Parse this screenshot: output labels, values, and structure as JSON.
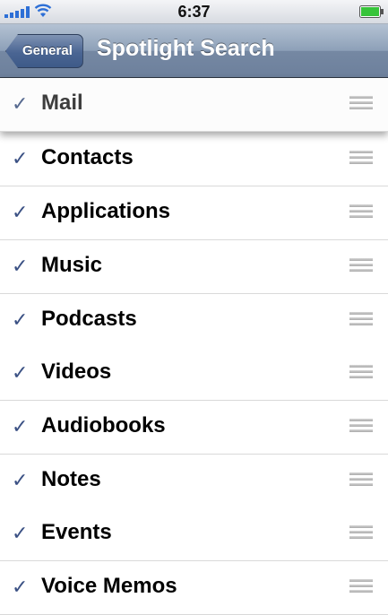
{
  "status_bar": {
    "time": "6:37"
  },
  "nav": {
    "back_label": "General",
    "title": "Spotlight Search"
  },
  "items": [
    {
      "label": "Mail",
      "checked": true
    },
    {
      "label": "Contacts",
      "checked": true
    },
    {
      "label": "Applications",
      "checked": true
    },
    {
      "label": "Music",
      "checked": true
    },
    {
      "label": "Podcasts",
      "checked": true
    },
    {
      "label": "Videos",
      "checked": true
    },
    {
      "label": "Audiobooks",
      "checked": true
    },
    {
      "label": "Notes",
      "checked": true
    },
    {
      "label": "Events",
      "checked": true
    },
    {
      "label": "Voice Memos",
      "checked": true
    }
  ],
  "icons": {
    "check": "✓",
    "checkmark_color": "#3b5184"
  }
}
